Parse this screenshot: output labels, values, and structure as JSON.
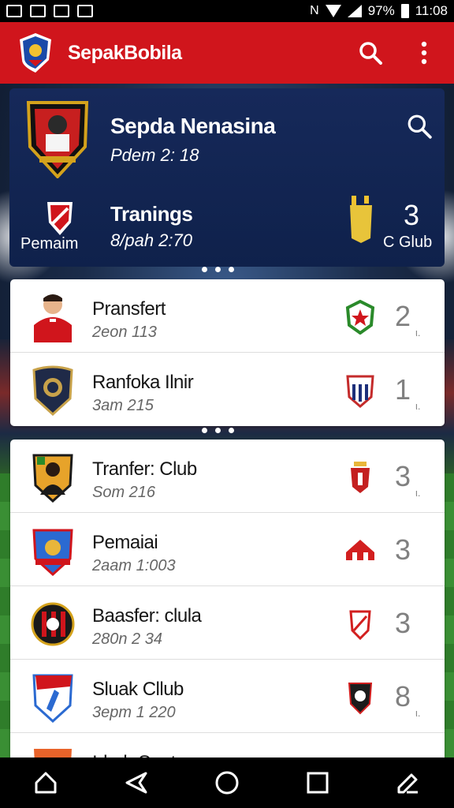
{
  "status_bar": {
    "icons": [
      "image-icon",
      "app-icon",
      "photo-icon",
      "gmail-icon"
    ],
    "right_icons": [
      "nfc-icon",
      "wifi-icon",
      "signal-icon"
    ],
    "battery": "97%",
    "time": "11:08"
  },
  "app_bar": {
    "title": "SepakBobila",
    "actions": [
      "search-icon",
      "more-vert-icon"
    ]
  },
  "featured": {
    "title": "Sepda Nenasina",
    "subtitle": "Pdem 2: 18",
    "secondary_title": "Tranings",
    "secondary_subtitle": "8/pah 2:70",
    "badge_label": "Pemaim",
    "score": "3",
    "score_label": "C Glub"
  },
  "list_group_1": [
    {
      "title": "Pransfert",
      "subtitle": "2eon 113",
      "score": "2",
      "tick": "ι.",
      "crest": "player-red-jersey",
      "badge_color": "#2a8a2a"
    },
    {
      "title": "Ranfoka Ilnir",
      "subtitle": "3am 215",
      "score": "1",
      "tick": "ι.",
      "crest": "navy-crest",
      "badge_color": "#c42b2b"
    }
  ],
  "list_group_2": [
    {
      "title": "Tranfer: Club",
      "subtitle": "Som 216",
      "score": "3",
      "tick": "ι.",
      "crest": "player-crest-green",
      "badge_color": "#c42020"
    },
    {
      "title": "Pemaiai",
      "subtitle": "2aam 1:003",
      "score": "3",
      "tick": "",
      "crest": "blue-red-crest",
      "badge_color": "#d21f1f"
    },
    {
      "title": "Baasfer: clula",
      "subtitle": "280n 2 34",
      "score": "3",
      "tick": "",
      "crest": "red-black-crest",
      "badge_color": "#d21f1f"
    },
    {
      "title": "Sluak Cllub",
      "subtitle": "3epm 1 220",
      "score": "8",
      "tick": "ι.",
      "crest": "blue-shield-crest",
      "badge_color": "#1c1c1c"
    },
    {
      "title": "Idorb Sapt",
      "subtitle": "",
      "score": "",
      "tick": "",
      "crest": "orange-crest",
      "badge_color": "#d21f1f"
    }
  ],
  "colors": {
    "primary": "#d0151c",
    "featured_bg": "#16295a",
    "score_grey": "#808080"
  },
  "nav_bar": [
    "home-icon",
    "back-icon",
    "recents-icon",
    "square-icon",
    "edit-icon"
  ]
}
